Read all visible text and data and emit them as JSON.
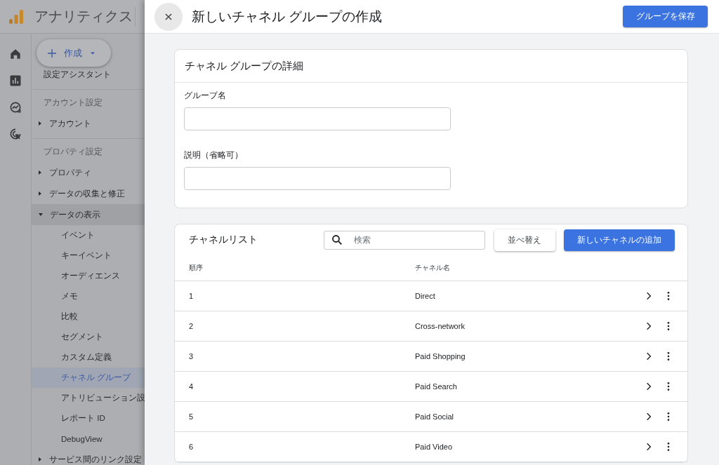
{
  "app": {
    "product": "アナリティクス",
    "create_button": "作成"
  },
  "nav": [
    {
      "kind": "item",
      "label": "設定アシスタント"
    },
    {
      "kind": "header",
      "label": "アカウント設定"
    },
    {
      "kind": "group",
      "label": "アカウント",
      "expanded": false
    },
    {
      "kind": "header",
      "label": "プロパティ設定"
    },
    {
      "kind": "group",
      "label": "プロパティ",
      "expanded": false
    },
    {
      "kind": "group",
      "label": "データの収集と修正",
      "expanded": false
    },
    {
      "kind": "group",
      "label": "データの表示",
      "expanded": true,
      "children": [
        {
          "label": "イベント",
          "selected": false
        },
        {
          "label": "キーイベント",
          "selected": false
        },
        {
          "label": "オーディエンス",
          "selected": false
        },
        {
          "label": "メモ",
          "selected": false
        },
        {
          "label": "比較",
          "selected": false
        },
        {
          "label": "セグメント",
          "selected": false
        },
        {
          "label": "カスタム定義",
          "selected": false
        },
        {
          "label": "チャネル グループ",
          "selected": true
        },
        {
          "label": "アトリビューション設",
          "selected": false
        },
        {
          "label": "レポート ID",
          "selected": false
        },
        {
          "label": "DebugView",
          "selected": false
        }
      ]
    },
    {
      "kind": "group",
      "label": "サービス間のリンク設定",
      "expanded": false
    }
  ],
  "dialog": {
    "title": "新しいチャネル グループの作成",
    "save_button": "グループを保存",
    "details": {
      "title": "チャネル グループの詳細",
      "fields": [
        {
          "label": "グループ名"
        },
        {
          "label": "説明（省略可）"
        }
      ]
    },
    "channel_list": {
      "title": "チャネルリスト",
      "search": {
        "placeholder": "検索"
      },
      "sort_button": "並べ替え",
      "add_button": "新しいチャネルの追加",
      "columns": [
        "順序",
        "チャネル名"
      ],
      "rows": [
        {
          "order": "1",
          "name": "Direct"
        },
        {
          "order": "2",
          "name": "Cross-network"
        },
        {
          "order": "3",
          "name": "Paid Shopping"
        },
        {
          "order": "4",
          "name": "Paid Search"
        },
        {
          "order": "5",
          "name": "Paid Social"
        },
        {
          "order": "6",
          "name": "Paid Video"
        }
      ]
    }
  }
}
